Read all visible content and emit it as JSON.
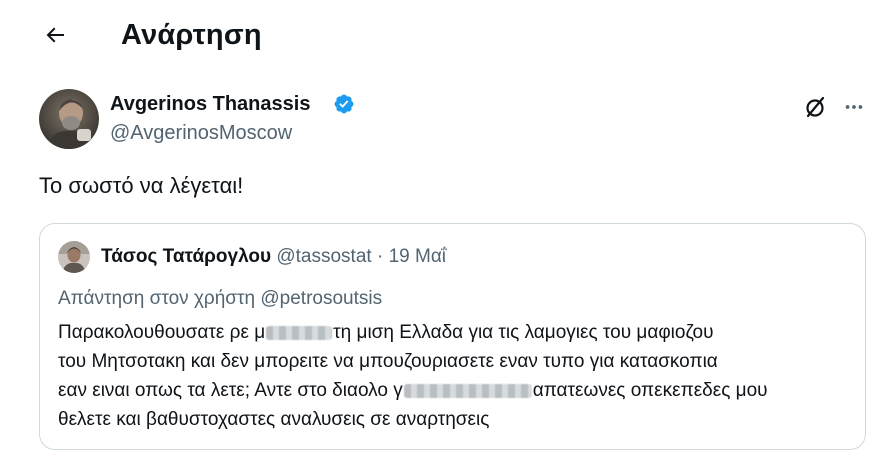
{
  "header": {
    "title": "Ανάρτηση"
  },
  "tweet": {
    "author_name": "Avgerinos Thanassis",
    "author_handle": "@AvgerinosMoscow",
    "text": "Το σωστό να λέγεται!"
  },
  "quote": {
    "author_name": "Τάσος Τατάρογλου",
    "author_handle": "@tassostat",
    "separator": "·",
    "date": "19 Μαΐ",
    "reply_prefix": "Απάντηση στον χρήστη",
    "reply_to": "@petrosoutsis",
    "body": {
      "line1_a": "Παρακολουθουσατε ρε μ",
      "line1_b": "τη μιση Ελλαδα για τις λαμογιες του μαφιοζου",
      "line2": "του Μητσοτακη και δεν μπορειτε να μπουζουριασετε εναν τυπο για κατασκοπια",
      "line3_a": "εαν ειναι οπως τα λετε; Αντε στο διαολο γ",
      "line3_b": "απατεωνες οπεκεπεδες μου",
      "line4": "θελετε και βαθυστοχαστες αναλυσεις σε αναρτησεις"
    }
  },
  "icons": {
    "back": "arrow-left-icon",
    "verified": "verified-badge-icon",
    "grok": "grok-icon",
    "more": "more-horizontal-icon"
  },
  "colors": {
    "text_primary": "#0f1419",
    "text_secondary": "#536471",
    "verified_blue": "#1d9bf0",
    "border": "#cfd9de"
  }
}
